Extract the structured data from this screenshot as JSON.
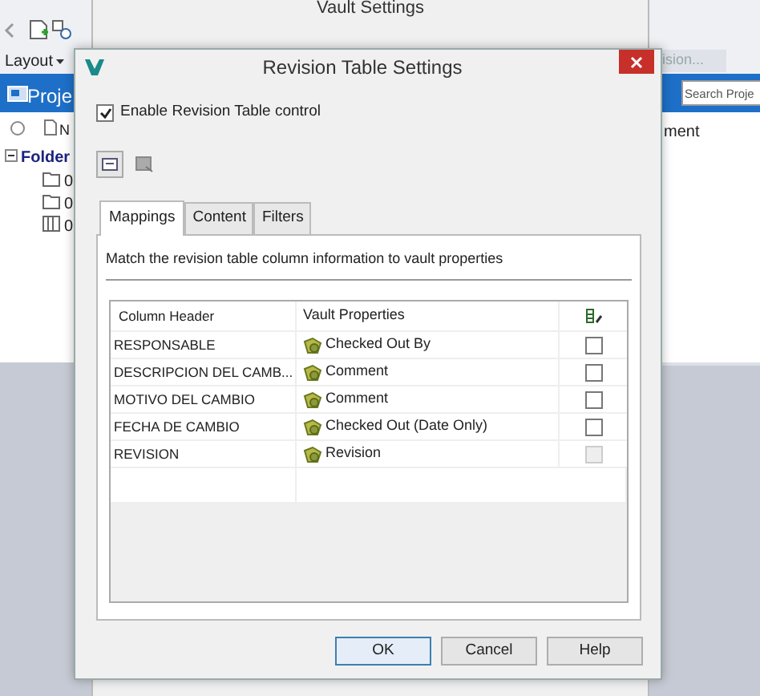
{
  "background_app": {
    "menu_label": "Layout",
    "partial_button": "ision...",
    "panel_title": "Proje",
    "search": {
      "placeholder": "Search Proje"
    },
    "column_headers": [
      "N",
      "ment"
    ],
    "tree": [
      {
        "label": "Folder",
        "expanded": true,
        "children": [
          {
            "label": "0",
            "kind": "folder"
          },
          {
            "label": "0",
            "kind": "folder"
          },
          {
            "label": "0",
            "kind": "library"
          }
        ]
      }
    ]
  },
  "back_window": {
    "title": "Vault Settings"
  },
  "dialog": {
    "title": "Revision Table Settings",
    "enable_control": {
      "label": "Enable Revision Table control",
      "checked": true
    },
    "tabs": [
      {
        "label": "Mappings",
        "selected": true
      },
      {
        "label": "Content",
        "selected": false
      },
      {
        "label": "Filters",
        "selected": false
      }
    ],
    "description": "Match the revision table column information to vault properties",
    "table": {
      "columns": [
        "Column Header",
        "Vault Properties"
      ],
      "rows": [
        {
          "header": "RESPONSABLE",
          "property": "Checked Out By",
          "checked": false,
          "disabled": false
        },
        {
          "header": "DESCRIPCION DEL CAMB...",
          "property": "Comment",
          "checked": false,
          "disabled": false
        },
        {
          "header": "MOTIVO DEL CAMBIO",
          "property": "Comment",
          "checked": false,
          "disabled": false
        },
        {
          "header": "FECHA DE CAMBIO",
          "property": "Checked Out (Date Only)",
          "checked": false,
          "disabled": false
        },
        {
          "header": "REVISION",
          "property": "Revision",
          "checked": false,
          "disabled": true
        }
      ]
    },
    "buttons": [
      {
        "label": "OK",
        "default": true
      },
      {
        "label": "Cancel",
        "default": false
      },
      {
        "label": "Help",
        "default": false
      }
    ]
  }
}
